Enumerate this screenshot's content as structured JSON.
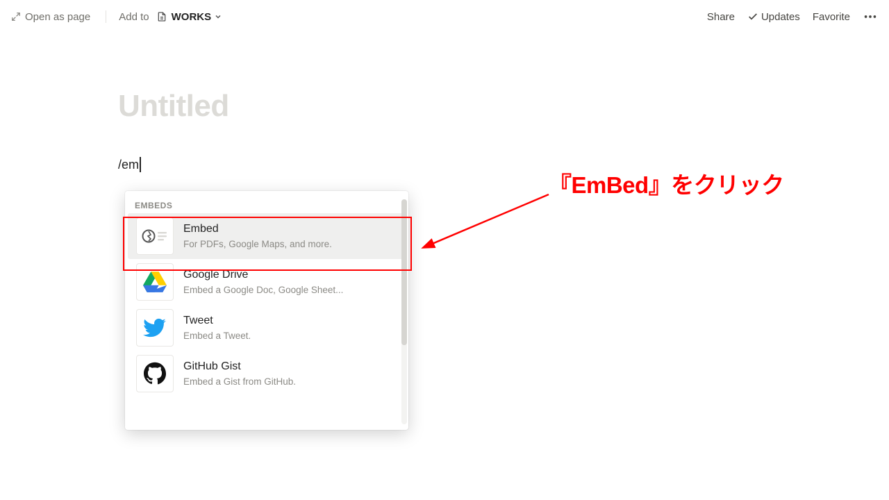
{
  "topbar": {
    "open_as_page": "Open as page",
    "add_to": "Add to",
    "breadcrumb_page": "WORKS",
    "share": "Share",
    "updates": "Updates",
    "favorite": "Favorite"
  },
  "page": {
    "title_placeholder": "Untitled",
    "slash_input": "/em"
  },
  "popup": {
    "section": "EMBEDS",
    "items": [
      {
        "title": "Embed",
        "desc": "For PDFs, Google Maps, and more."
      },
      {
        "title": "Google Drive",
        "desc": "Embed a Google Doc, Google Sheet..."
      },
      {
        "title": "Tweet",
        "desc": "Embed a Tweet."
      },
      {
        "title": "GitHub Gist",
        "desc": "Embed a Gist from GitHub."
      }
    ]
  },
  "annotation": {
    "text": "『EmBed』をクリック"
  }
}
